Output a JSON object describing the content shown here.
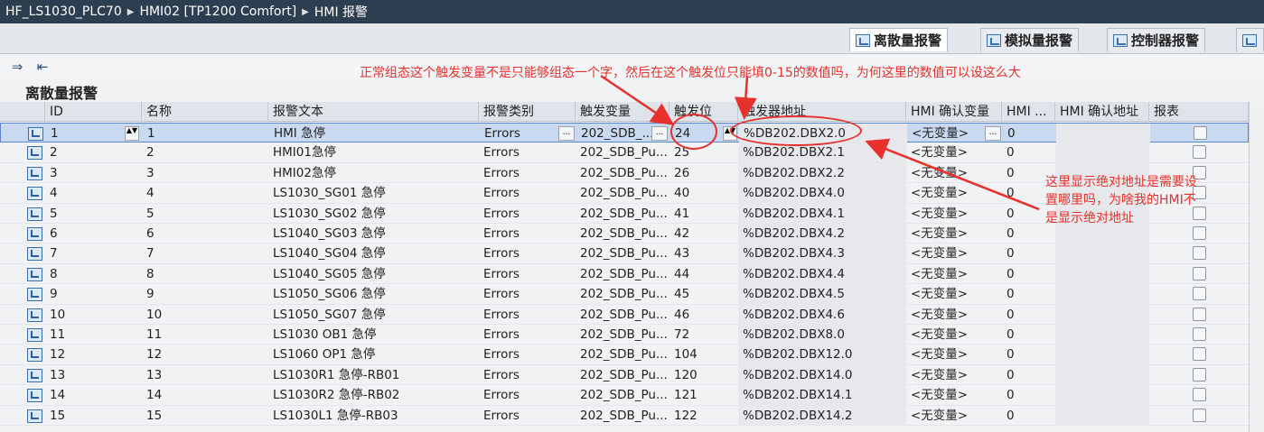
{
  "breadcrumb": [
    "HF_LS1030_PLC70",
    "HMI02 [TP1200 Comfort]",
    "HMI 报警"
  ],
  "tabs": [
    {
      "label": "离散量报警",
      "active": true
    },
    {
      "label": "模拟量报警",
      "active": false
    },
    {
      "label": "控制器报警",
      "active": false
    }
  ],
  "section_title": "离散量报警",
  "columns": [
    "ID",
    "名称",
    "报警文本",
    "报警类别",
    "触发变量",
    "触发位",
    "触发器地址",
    "HMI 确认变量",
    "HMI ...",
    "HMI 确认地址",
    "报表"
  ],
  "rows": [
    {
      "id": "1",
      "name": "1",
      "text": "HMI 急停",
      "cat": "Errors",
      "var": "202_SDB_...",
      "bit": "24",
      "addr": "%DB202.DBX2.0",
      "ack": "<无变量>",
      "hmi": "0"
    },
    {
      "id": "2",
      "name": "2",
      "text": "HMI01急停",
      "cat": "Errors",
      "var": "202_SDB_Pu...",
      "bit": "25",
      "addr": "%DB202.DBX2.1",
      "ack": "<无变量>",
      "hmi": "0"
    },
    {
      "id": "3",
      "name": "3",
      "text": "HMI02急停",
      "cat": "Errors",
      "var": "202_SDB_Pu...",
      "bit": "26",
      "addr": "%DB202.DBX2.2",
      "ack": "<无变量>",
      "hmi": "0"
    },
    {
      "id": "4",
      "name": "4",
      "text": "LS1030_SG01 急停",
      "cat": "Errors",
      "var": "202_SDB_Pu...",
      "bit": "40",
      "addr": "%DB202.DBX4.0",
      "ack": "<无变量>",
      "hmi": "0"
    },
    {
      "id": "5",
      "name": "5",
      "text": "LS1030_SG02 急停",
      "cat": "Errors",
      "var": "202_SDB_Pu...",
      "bit": "41",
      "addr": "%DB202.DBX4.1",
      "ack": "<无变量>",
      "hmi": "0"
    },
    {
      "id": "6",
      "name": "6",
      "text": "LS1040_SG03 急停",
      "cat": "Errors",
      "var": "202_SDB_Pu...",
      "bit": "42",
      "addr": "%DB202.DBX4.2",
      "ack": "<无变量>",
      "hmi": "0"
    },
    {
      "id": "7",
      "name": "7",
      "text": "LS1040_SG04 急停",
      "cat": "Errors",
      "var": "202_SDB_Pu...",
      "bit": "43",
      "addr": "%DB202.DBX4.3",
      "ack": "<无变量>",
      "hmi": "0"
    },
    {
      "id": "8",
      "name": "8",
      "text": "LS1040_SG05 急停",
      "cat": "Errors",
      "var": "202_SDB_Pu...",
      "bit": "44",
      "addr": "%DB202.DBX4.4",
      "ack": "<无变量>",
      "hmi": "0"
    },
    {
      "id": "9",
      "name": "9",
      "text": "LS1050_SG06 急停",
      "cat": "Errors",
      "var": "202_SDB_Pu...",
      "bit": "45",
      "addr": "%DB202.DBX4.5",
      "ack": "<无变量>",
      "hmi": "0"
    },
    {
      "id": "10",
      "name": "10",
      "text": "LS1050_SG07 急停",
      "cat": "Errors",
      "var": "202_SDB_Pu...",
      "bit": "46",
      "addr": "%DB202.DBX4.6",
      "ack": "<无变量>",
      "hmi": "0"
    },
    {
      "id": "11",
      "name": "11",
      "text": "LS1030 OB1 急停",
      "cat": "Errors",
      "var": "202_SDB_Pu...",
      "bit": "72",
      "addr": "%DB202.DBX8.0",
      "ack": "<无变量>",
      "hmi": "0"
    },
    {
      "id": "12",
      "name": "12",
      "text": "LS1060 OP1 急停",
      "cat": "Errors",
      "var": "202_SDB_Pu...",
      "bit": "104",
      "addr": "%DB202.DBX12.0",
      "ack": "<无变量>",
      "hmi": "0"
    },
    {
      "id": "13",
      "name": "13",
      "text": "LS1030R1 急停-RB01",
      "cat": "Errors",
      "var": "202_SDB_Pu...",
      "bit": "120",
      "addr": "%DB202.DBX14.0",
      "ack": "<无变量>",
      "hmi": "0"
    },
    {
      "id": "14",
      "name": "14",
      "text": "LS1030R2 急停-RB02",
      "cat": "Errors",
      "var": "202_SDB_Pu...",
      "bit": "121",
      "addr": "%DB202.DBX14.1",
      "ack": "<无变量>",
      "hmi": "0"
    },
    {
      "id": "15",
      "name": "15",
      "text": "LS1030L1 急停-RB03",
      "cat": "Errors",
      "var": "202_SDB_Pu...",
      "bit": "122",
      "addr": "%DB202.DBX14.2",
      "ack": "<无变量>",
      "hmi": "0"
    }
  ],
  "annotations": {
    "top": "正常组态这个触发变量不是只能够组态一个字，然后在这个触发位只能填0-15的数值吗，为何这里的数值可以设这么大",
    "right": "这里显示绝对地址是需要设置哪里吗，为啥我的HMI不是显示绝对地址"
  },
  "colors": {
    "accent": "#e8302c",
    "titlebar": "#2d3e50",
    "selected": "#c9d9f0"
  }
}
